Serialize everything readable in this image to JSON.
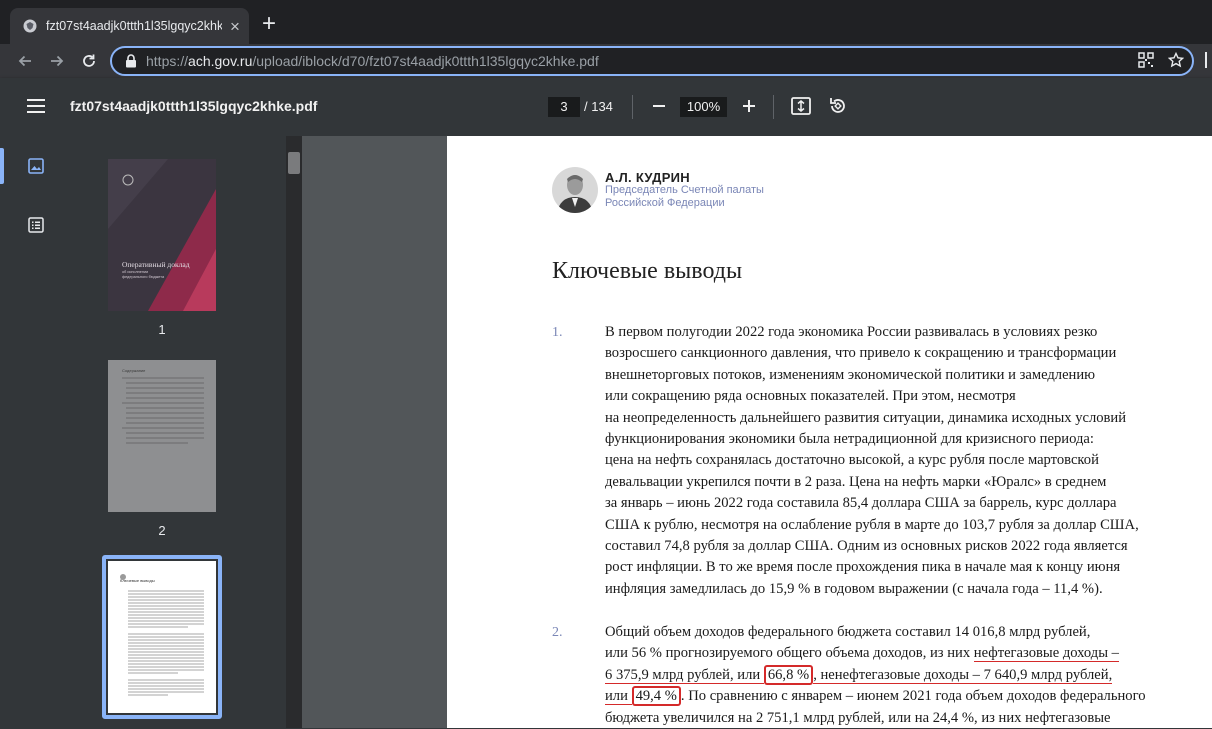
{
  "browser": {
    "tab_title": "fzt07st4aadjk0ttth1l35lgqyc2khke.pdf",
    "tab_close": "×",
    "new_tab": "+",
    "url_scheme": "https://",
    "url_host": "ach.gov.ru",
    "url_path": "/upload/iblock/d70/fzt07st4aadjk0ttth1l35lgqyc2khke.pdf"
  },
  "viewer": {
    "filename": "fzt07st4aadjk0ttth1l35lgqyc2khke.pdf",
    "current_page": "3",
    "page_total": "/ 134",
    "zoom": "100%"
  },
  "thumbnails": [
    {
      "label": "1",
      "cover_title": "Оперативный доклад",
      "cover_sub1": "об исполнении",
      "cover_sub2": "федерального бюджета"
    },
    {
      "label": "2",
      "toc_title": "Содержание"
    },
    {
      "label": "3",
      "title": "Ключевые выводы"
    }
  ],
  "page": {
    "author_name": "А.Л. КУДРИН",
    "author_role_1": "Председатель Счетной палаты",
    "author_role_2": "Российской Федерации",
    "heading": "Ключевые выводы",
    "item1_num": "1.",
    "item1_lines": [
      "В первом полугодии 2022 года экономика России развивалась в условиях резко",
      "возросшего санкционного давления, что привело к сокращению и трансформации",
      "внешнеторговых потоков, изменениям экономической политики и замедлению",
      "или сокращению ряда основных показателей. При этом, несмотря",
      "на неопределенность дальнейшего развития ситуации, динамика исходных условий",
      "функционирования экономики была нетрадиционной для кризисного периода:",
      "цена на нефть сохранялась достаточно высокой, а курс рубля после мартовской",
      "девальвации укрепился почти в 2 раза. Цена на нефть марки «Юралс» в среднем",
      "за январь – июнь 2022 года составила 85,4 доллара США за баррель, курс доллара",
      "США к рублю, несмотря на ослабление рубля в марте до 103,7 рубля за доллар США,",
      "составил 74,8 рубля за доллар США. Одним из основных рисков 2022 года является",
      "рост инфляции. В то же время после прохождения пика в начале мая к концу июня",
      "инфляция замедлилась до 15,9 % в годовом выражении (с начала года – 11,4 %)."
    ],
    "item2_num": "2.",
    "item2": {
      "l1": "Общий объем доходов федерального бюджета составил 14 016,8 млрд рублей,",
      "l2a": "или 56 % прогнозируемого общего объема доходов, из них ",
      "l2b": "нефтегазовые доходы –",
      "l3a": "6 375,9 млрд рублей, или ",
      "l3b": "66,8 %",
      "l3c": ",",
      "l3d": " ненефтегазовые доходы – 7 640,9 млрд рублей,",
      "l4a": "или ",
      "l4b": "49,4 %",
      "l4c": ". По сравнению с январем – июнем 2021 года объем доходов федерального",
      "l5": "бюджета увеличился на 2 751,1 млрд рублей, или на 24,4 %, из них нефтегазовые"
    }
  }
}
